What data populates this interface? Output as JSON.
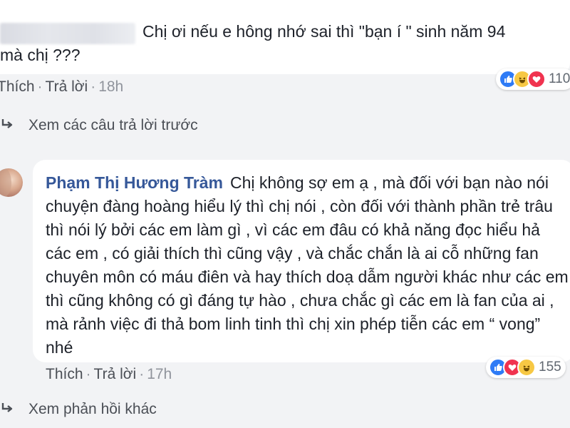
{
  "top_comment": {
    "text_line1": "Chị ơi nếu e hông nhớ sai thì \"bạn í \" sinh năm 94",
    "text_line2": "mà chị ???",
    "like_label": "Thích",
    "reply_label": "Trả lời",
    "time": "18h",
    "reaction_count": "110"
  },
  "view_previous_replies": "Xem các câu trả lời trước",
  "main_comment": {
    "author": "Phạm Thị Hương Tràm",
    "text": "Chị không sợ em ạ , mà đối với bạn nào nói chuyện đàng hoàng hiểu lý thì chị nói , còn đối với thành phần trẻ trâu thì nói lý bởi các em làm gì , vì các em đâu có khả năng đọc hiểu hả các em , có giải thích thì cũng vậy , và chắc chắn là ai cỗ những fan chuyên môn có máu điên và hay thích doạ dẫm người khác như các em thì cũng không có gì đáng tự hào , chưa chắc gì các em là fan của ai , mà rảnh việc đi thả bom linh tinh thì chị xin phép tiễn các em “ vong” nhé",
    "like_label": "Thích",
    "reply_label": "Trả lời",
    "time": "17h",
    "reaction_count": "155"
  },
  "view_other_replies": "Xem phản hồi khác",
  "icons": {
    "reply_arrow": "reply-arrow-icon",
    "like": "like-reaction-icon",
    "haha": "haha-reaction-icon",
    "love": "love-reaction-icon"
  },
  "colors": {
    "background": "#f2f3f5",
    "bubble": "#ffffff",
    "author_link": "#365899",
    "like_blue": "#2e7bf6",
    "love_red": "#f0334f",
    "haha_yellow": "#f7c844"
  }
}
